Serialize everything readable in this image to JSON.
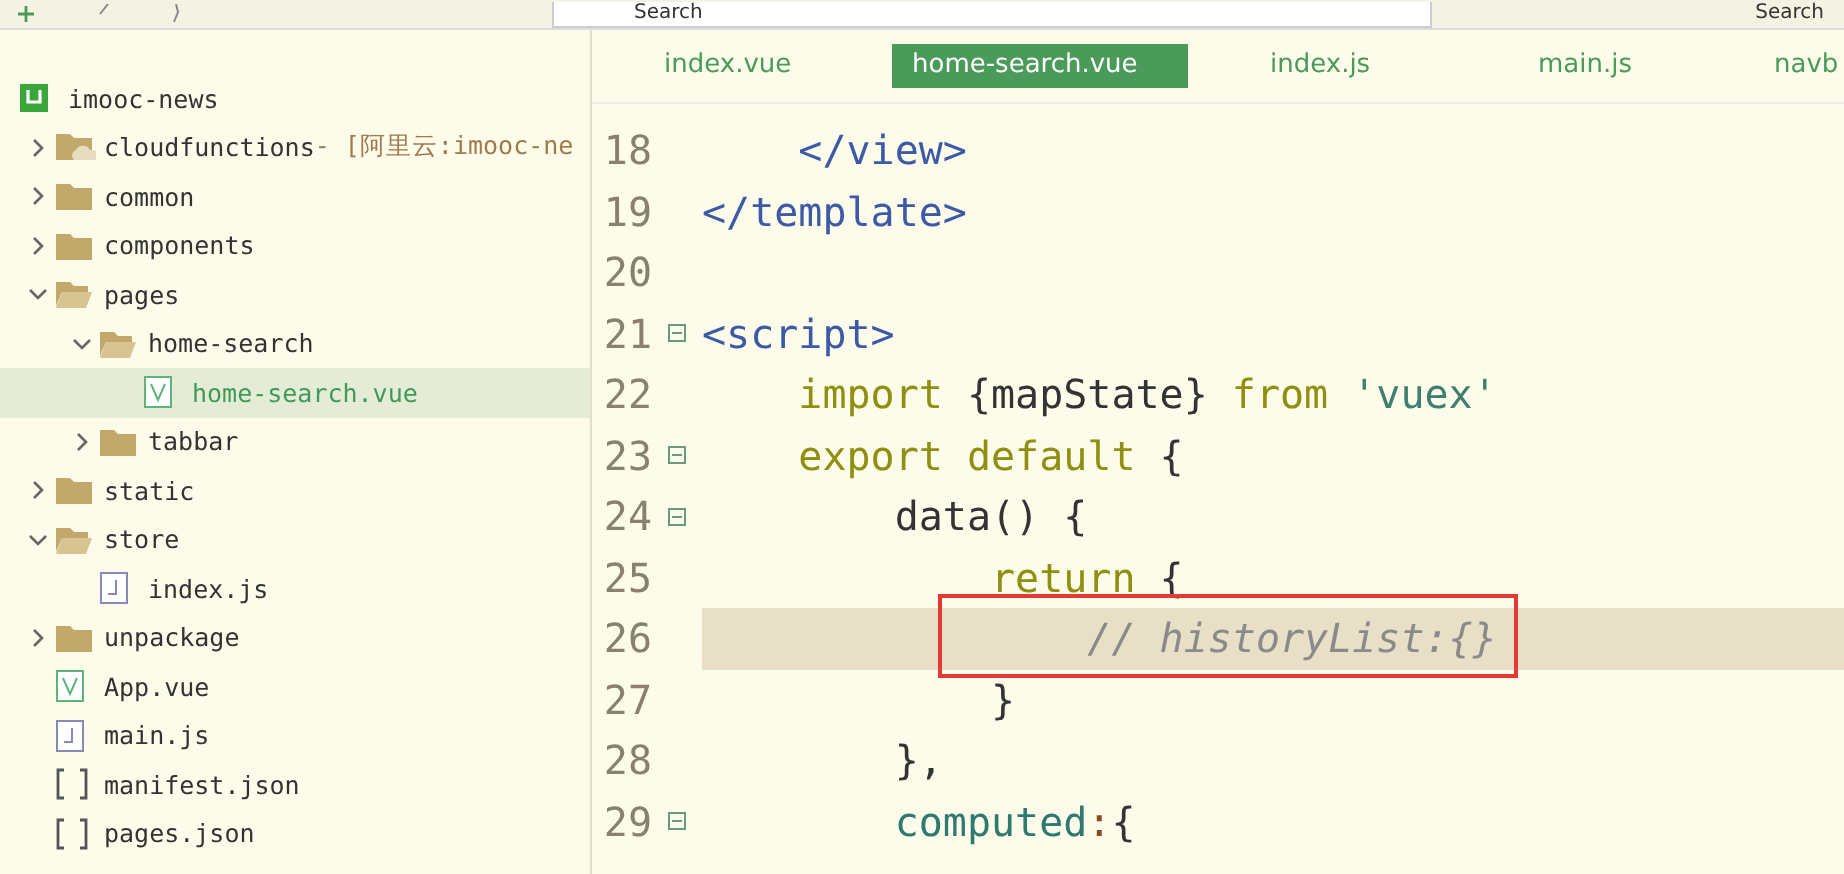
{
  "toolbar": {
    "search_value": "Search",
    "search_button": "Search"
  },
  "project": {
    "label": "imooc-news",
    "kind": "project",
    "selected": false,
    "children": [
      {
        "label": "cloudfunctions",
        "suffix": " - [阿里云:imooc-ne",
        "kind": "cloud",
        "expanded": false,
        "selected": false
      },
      {
        "label": "common",
        "kind": "folder",
        "expanded": false,
        "selected": false
      },
      {
        "label": "components",
        "kind": "folder",
        "expanded": false,
        "selected": false
      },
      {
        "label": "pages",
        "kind": "folder",
        "expanded": true,
        "selected": false,
        "children": [
          {
            "label": "home-search",
            "kind": "folder",
            "expanded": true,
            "selected": false,
            "children": [
              {
                "label": "home-search.vue",
                "kind": "vue",
                "selected": true
              }
            ]
          },
          {
            "label": "tabbar",
            "kind": "folder",
            "expanded": false,
            "selected": false
          }
        ]
      },
      {
        "label": "static",
        "kind": "folder",
        "expanded": false,
        "selected": false
      },
      {
        "label": "store",
        "kind": "folder",
        "expanded": true,
        "selected": false,
        "children": [
          {
            "label": "index.js",
            "kind": "js",
            "selected": false
          }
        ]
      },
      {
        "label": "unpackage",
        "kind": "folder",
        "expanded": false,
        "selected": false
      },
      {
        "label": "App.vue",
        "kind": "vue",
        "selected": false
      },
      {
        "label": "main.js",
        "kind": "js",
        "selected": false
      },
      {
        "label": "manifest.json",
        "kind": "json",
        "selected": false
      },
      {
        "label": "pages.json",
        "kind": "json",
        "selected": false
      }
    ]
  },
  "tabs": [
    {
      "label": "index.vue",
      "selected": false
    },
    {
      "label": "home-search.vue",
      "selected": true
    },
    {
      "label": "index.js",
      "selected": false
    },
    {
      "label": "main.js",
      "selected": false
    },
    {
      "label": "navb",
      "selected": false
    }
  ],
  "lines": [
    {
      "number": "18",
      "fold": false,
      "highlighted": false,
      "marked": false,
      "tokens": [
        {
          "kind": "tag",
          "text": "    </view>"
        }
      ]
    },
    {
      "number": "19",
      "fold": false,
      "highlighted": false,
      "marked": false,
      "tokens": [
        {
          "kind": "tag",
          "text": "</template>"
        }
      ]
    },
    {
      "number": "20",
      "fold": false,
      "highlighted": false,
      "marked": false
    },
    {
      "number": "21",
      "fold": true,
      "highlighted": false,
      "marked": false,
      "tokens": [
        {
          "kind": "tag",
          "text": "<script>"
        }
      ]
    },
    {
      "number": "22",
      "fold": false,
      "highlighted": false,
      "marked": false,
      "tokens": [
        {
          "kind": "keyword",
          "text": "    import"
        },
        {
          "kind": "plain",
          "text": " {mapState} "
        },
        {
          "kind": "keyword",
          "text": "from"
        },
        {
          "kind": "string",
          "text": " 'vuex'"
        }
      ]
    },
    {
      "number": "23",
      "fold": true,
      "highlighted": false,
      "marked": false,
      "tokens": [
        {
          "kind": "keyword",
          "text": "    export default"
        },
        {
          "kind": "plain",
          "text": " {"
        }
      ]
    },
    {
      "number": "24",
      "fold": true,
      "highlighted": false,
      "marked": false,
      "tokens": [
        {
          "kind": "plain",
          "text": "        data() {"
        }
      ]
    },
    {
      "number": "25",
      "fold": false,
      "highlighted": false,
      "marked": false,
      "tokens": [
        {
          "kind": "keyword",
          "text": "            return"
        },
        {
          "kind": "plain",
          "text": " {"
        }
      ]
    },
    {
      "number": "26",
      "fold": false,
      "highlighted": true,
      "marked": true,
      "tokens": [
        {
          "kind": "comment",
          "text": "                // historyList:{}"
        }
      ]
    },
    {
      "number": "27",
      "fold": false,
      "highlighted": false,
      "marked": false,
      "tokens": [
        {
          "kind": "plain",
          "text": "            }"
        }
      ]
    },
    {
      "number": "28",
      "fold": false,
      "highlighted": false,
      "marked": false,
      "tokens": [
        {
          "kind": "plain",
          "text": "        },"
        }
      ]
    },
    {
      "number": "29",
      "fold": true,
      "highlighted": false,
      "marked": false,
      "tokens": [
        {
          "kind": "property",
          "text": "        computed"
        },
        {
          "kind": "punct",
          "text": ":"
        },
        {
          "kind": "plain",
          "text": "{"
        }
      ]
    }
  ]
}
